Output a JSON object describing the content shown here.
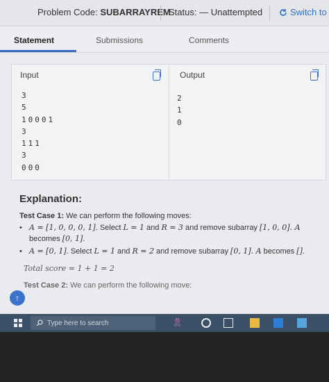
{
  "header": {
    "problem_code_label": "Problem Code:",
    "problem_code": "SUBARRAYREM",
    "status_label": "Status:",
    "status_value": "— Unattempted",
    "switch_label": "Switch to"
  },
  "tabs": [
    {
      "label": "Statement",
      "active": true
    },
    {
      "label": "Submissions",
      "active": false
    },
    {
      "label": "Comments",
      "active": false
    }
  ],
  "io": {
    "input_label": "Input",
    "output_label": "Output",
    "input_lines": [
      "3",
      "5",
      "10001",
      "3",
      "111",
      "3",
      "000"
    ],
    "output_lines": [
      "2",
      "1",
      "0"
    ]
  },
  "explanation": {
    "title": "Explanation:",
    "test_case_1_label": "Test Case 1:",
    "test_case_1_intro": "We can perform the following moves:",
    "tc1_move1_a": "A = [1, 0, 0, 0, 1]",
    "tc1_move1_select": ". Select ",
    "tc1_move1_l": "L = 1",
    "tc1_move1_and": " and ",
    "tc1_move1_r": "R = 3",
    "tc1_move1_remove": " and remove subarray ",
    "tc1_move1_sub": "[1, 0, 0]",
    "tc1_move1_becomes_a": ". A",
    "tc1_move1_becomes": " becomes ",
    "tc1_move1_result": "[0, 1]",
    "tc1_move1_end": ".",
    "tc1_move2_a": "A = [0, 1]",
    "tc1_move2_select": ". Select ",
    "tc1_move2_l": "L = 1",
    "tc1_move2_and": " and ",
    "tc1_move2_r": "R = 2",
    "tc1_move2_remove": " and remove subarray ",
    "tc1_move2_sub": "[0, 1]",
    "tc1_move2_becomes_a": ". A",
    "tc1_move2_becomes": " becomes ",
    "tc1_move2_result": "[]",
    "tc1_move2_end": ".",
    "total_score": "Total score = 1 + 1 = 2",
    "test_case_2_label": "Test Case 2:",
    "test_case_2_intro": "We can perform the following move:"
  },
  "taskbar": {
    "search_placeholder": "Type here to search"
  },
  "colors": {
    "accent": "#3466c2",
    "taskbar": "#3b4f66",
    "screen_bg": "#e9ebee"
  },
  "icons": [
    "windows-logo-icon",
    "search-icon",
    "cortana-circle-icon",
    "task-view-icon",
    "file-explorer-icon",
    "store-icon",
    "mail-icon",
    "copy-icon",
    "refresh-icon",
    "arrow-up-icon",
    "ribbon-icon"
  ]
}
